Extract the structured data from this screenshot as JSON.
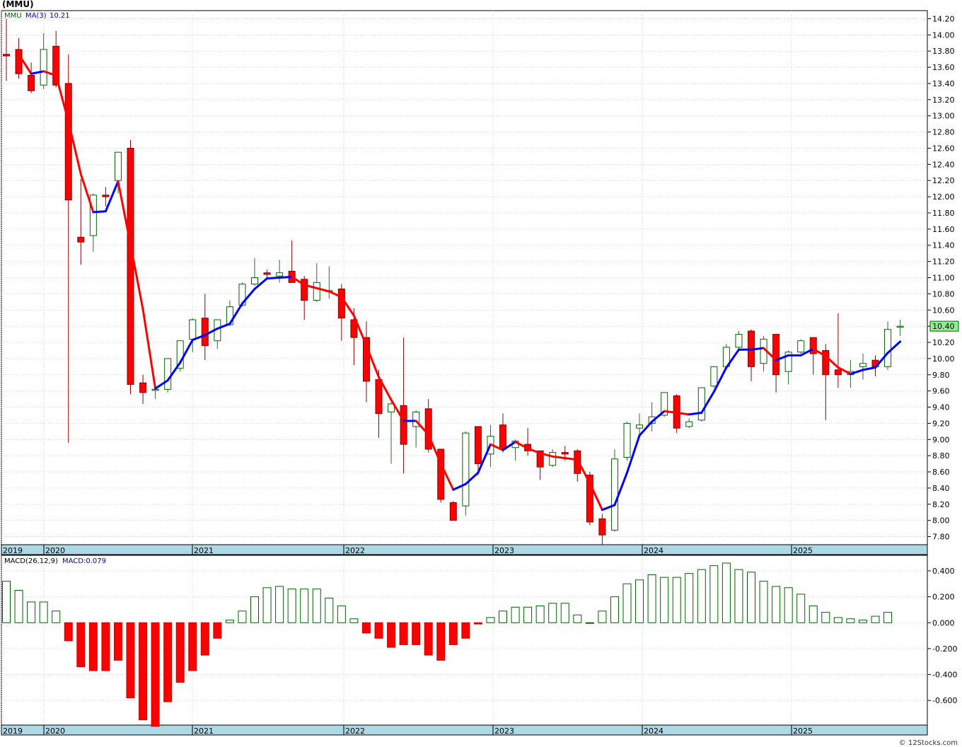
{
  "title": "(MMU)",
  "credit": "© 12Stocks.com",
  "chart_data": [
    {
      "type": "candlestick",
      "symbol": "MMU",
      "legend": {
        "symbol_label": "MMU",
        "ma_label": "MA(3)",
        "ma_value": "10.21"
      },
      "last_price_label": "10.40",
      "y_ticks": [
        "14.20",
        "14.00",
        "13.80",
        "13.60",
        "13.40",
        "13.20",
        "13.00",
        "12.80",
        "12.60",
        "12.40",
        "12.20",
        "12.00",
        "11.80",
        "11.60",
        "11.40",
        "11.20",
        "11.00",
        "10.80",
        "10.60",
        "10.40",
        "10.20",
        "10.00",
        "9.80",
        "9.60",
        "9.40",
        "9.20",
        "9.00",
        "8.80",
        "8.60",
        "8.40",
        "8.20",
        "8.00",
        "7.80"
      ],
      "ylim": [
        7.7,
        14.3
      ],
      "x_labels": [
        "2019",
        "2020",
        "2021",
        "2022",
        "2023",
        "2024",
        "2025"
      ],
      "grid": true,
      "candles": [
        {
          "o": 13.76,
          "h": 14.2,
          "l": 13.43,
          "c": 13.74
        },
        {
          "o": 13.82,
          "h": 13.96,
          "l": 13.46,
          "c": 13.52
        },
        {
          "o": 13.5,
          "h": 13.66,
          "l": 13.28,
          "c": 13.31
        },
        {
          "o": 13.38,
          "h": 14.02,
          "l": 13.33,
          "c": 13.82
        },
        {
          "o": 13.86,
          "h": 14.05,
          "l": 13.35,
          "c": 13.38
        },
        {
          "o": 13.4,
          "h": 13.76,
          "l": 8.96,
          "c": 11.96
        },
        {
          "o": 11.5,
          "h": 12.22,
          "l": 11.16,
          "c": 11.44
        },
        {
          "o": 11.52,
          "h": 12.04,
          "l": 11.32,
          "c": 12.02
        },
        {
          "o": 12.02,
          "h": 12.12,
          "l": 11.88,
          "c": 12.0
        },
        {
          "o": 12.2,
          "h": 12.55,
          "l": 12.04,
          "c": 12.55
        },
        {
          "o": 12.6,
          "h": 12.7,
          "l": 9.56,
          "c": 9.68
        },
        {
          "o": 9.7,
          "h": 9.8,
          "l": 9.44,
          "c": 9.58
        },
        {
          "o": 9.62,
          "h": 9.64,
          "l": 9.5,
          "c": 9.62
        },
        {
          "o": 9.62,
          "h": 10.0,
          "l": 9.58,
          "c": 10.0
        },
        {
          "o": 9.88,
          "h": 10.22,
          "l": 9.84,
          "c": 10.22
        },
        {
          "o": 10.24,
          "h": 10.5,
          "l": 10.08,
          "c": 10.48
        },
        {
          "o": 10.5,
          "h": 10.8,
          "l": 9.98,
          "c": 10.16
        },
        {
          "o": 10.22,
          "h": 10.48,
          "l": 10.12,
          "c": 10.48
        },
        {
          "o": 10.42,
          "h": 10.72,
          "l": 10.4,
          "c": 10.64
        },
        {
          "o": 10.66,
          "h": 10.94,
          "l": 10.64,
          "c": 10.92
        },
        {
          "o": 10.92,
          "h": 11.24,
          "l": 10.9,
          "c": 11.0
        },
        {
          "o": 11.06,
          "h": 11.1,
          "l": 10.98,
          "c": 11.04
        },
        {
          "o": 11.02,
          "h": 11.22,
          "l": 10.94,
          "c": 11.06
        },
        {
          "o": 11.08,
          "h": 11.46,
          "l": 10.94,
          "c": 10.94
        },
        {
          "o": 10.98,
          "h": 11.02,
          "l": 10.48,
          "c": 10.72
        },
        {
          "o": 10.72,
          "h": 11.18,
          "l": 10.7,
          "c": 10.94
        },
        {
          "o": 10.84,
          "h": 11.14,
          "l": 10.74,
          "c": 10.84
        },
        {
          "o": 10.86,
          "h": 10.92,
          "l": 10.22,
          "c": 10.5
        },
        {
          "o": 10.48,
          "h": 10.62,
          "l": 9.92,
          "c": 10.26
        },
        {
          "o": 10.26,
          "h": 10.46,
          "l": 9.46,
          "c": 9.72
        },
        {
          "o": 9.74,
          "h": 9.86,
          "l": 9.02,
          "c": 9.32
        },
        {
          "o": 9.34,
          "h": 9.46,
          "l": 8.7,
          "c": 9.44
        },
        {
          "o": 9.42,
          "h": 10.26,
          "l": 8.58,
          "c": 8.94
        },
        {
          "o": 9.16,
          "h": 9.36,
          "l": 8.9,
          "c": 9.34
        },
        {
          "o": 9.38,
          "h": 9.5,
          "l": 8.84,
          "c": 8.88
        },
        {
          "o": 8.88,
          "h": 8.88,
          "l": 8.22,
          "c": 8.26
        },
        {
          "o": 8.22,
          "h": 8.24,
          "l": 8.06,
          "c": 8.0
        },
        {
          "o": 8.18,
          "h": 9.1,
          "l": 8.06,
          "c": 9.08
        },
        {
          "o": 9.16,
          "h": 9.16,
          "l": 8.56,
          "c": 8.7
        },
        {
          "o": 8.82,
          "h": 9.18,
          "l": 8.66,
          "c": 9.04
        },
        {
          "o": 9.18,
          "h": 9.32,
          "l": 8.84,
          "c": 8.88
        },
        {
          "o": 8.9,
          "h": 9.0,
          "l": 8.74,
          "c": 8.98
        },
        {
          "o": 8.94,
          "h": 9.14,
          "l": 8.8,
          "c": 8.86
        },
        {
          "o": 8.86,
          "h": 8.86,
          "l": 8.5,
          "c": 8.66
        },
        {
          "o": 8.68,
          "h": 8.88,
          "l": 8.66,
          "c": 8.84
        },
        {
          "o": 8.84,
          "h": 8.92,
          "l": 8.74,
          "c": 8.82
        },
        {
          "o": 8.86,
          "h": 8.88,
          "l": 8.48,
          "c": 8.58
        },
        {
          "o": 8.56,
          "h": 8.6,
          "l": 7.94,
          "c": 7.98
        },
        {
          "o": 8.02,
          "h": 8.08,
          "l": 7.7,
          "c": 7.82
        },
        {
          "o": 7.88,
          "h": 8.88,
          "l": 7.86,
          "c": 8.76
        },
        {
          "o": 8.78,
          "h": 9.22,
          "l": 8.74,
          "c": 9.2
        },
        {
          "o": 9.14,
          "h": 9.32,
          "l": 9.02,
          "c": 9.18
        },
        {
          "o": 9.2,
          "h": 9.46,
          "l": 9.1,
          "c": 9.28
        },
        {
          "o": 9.3,
          "h": 9.58,
          "l": 9.28,
          "c": 9.58
        },
        {
          "o": 9.54,
          "h": 9.56,
          "l": 9.08,
          "c": 9.14
        },
        {
          "o": 9.16,
          "h": 9.26,
          "l": 9.14,
          "c": 9.22
        },
        {
          "o": 9.24,
          "h": 9.64,
          "l": 9.22,
          "c": 9.64
        },
        {
          "o": 9.66,
          "h": 9.9,
          "l": 9.64,
          "c": 9.9
        },
        {
          "o": 9.9,
          "h": 10.18,
          "l": 9.86,
          "c": 10.14
        },
        {
          "o": 10.14,
          "h": 10.34,
          "l": 10.12,
          "c": 10.3
        },
        {
          "o": 10.34,
          "h": 10.36,
          "l": 9.72,
          "c": 9.9
        },
        {
          "o": 9.94,
          "h": 10.28,
          "l": 9.84,
          "c": 10.24
        },
        {
          "o": 10.3,
          "h": 10.3,
          "l": 9.58,
          "c": 9.8
        },
        {
          "o": 9.84,
          "h": 10.1,
          "l": 9.68,
          "c": 10.08
        },
        {
          "o": 10.08,
          "h": 10.24,
          "l": 10.06,
          "c": 10.22
        },
        {
          "o": 10.26,
          "h": 10.26,
          "l": 9.8,
          "c": 10.06
        },
        {
          "o": 10.1,
          "h": 10.18,
          "l": 9.24,
          "c": 9.8
        },
        {
          "o": 9.86,
          "h": 10.56,
          "l": 9.64,
          "c": 9.8
        },
        {
          "o": 9.8,
          "h": 9.98,
          "l": 9.64,
          "c": 9.84
        },
        {
          "o": 9.9,
          "h": 10.06,
          "l": 9.74,
          "c": 9.94
        },
        {
          "o": 9.98,
          "h": 10.04,
          "l": 9.78,
          "c": 9.9
        },
        {
          "o": 9.9,
          "h": 10.46,
          "l": 9.86,
          "c": 10.36
        },
        {
          "o": 10.4,
          "h": 10.48,
          "l": 10.28,
          "c": 10.4
        }
      ],
      "ma3": [
        null,
        13.76,
        13.52,
        13.55,
        13.5,
        12.93,
        12.28,
        11.81,
        11.82,
        12.19,
        11.41,
        10.61,
        9.63,
        9.73,
        9.95,
        10.23,
        10.29,
        10.37,
        10.43,
        10.68,
        10.86,
        10.99,
        11.0,
        11.01,
        10.91,
        10.87,
        10.83,
        10.76,
        10.53,
        10.16,
        9.77,
        9.49,
        9.23,
        9.23,
        9.06,
        8.7,
        8.38,
        8.45,
        8.59,
        8.94,
        8.87,
        8.97,
        8.89,
        8.83,
        8.79,
        8.77,
        8.75,
        8.46,
        8.13,
        8.19,
        8.59,
        9.05,
        9.22,
        9.35,
        9.33,
        9.31,
        9.33,
        9.59,
        9.89,
        10.11,
        10.11,
        10.13,
        9.98,
        10.04,
        10.04,
        10.12,
        10.03,
        9.89,
        9.81,
        9.86,
        9.89,
        10.07,
        10.21
      ],
      "ma3_label_value": "10.21"
    },
    {
      "type": "bar",
      "name": "MACD",
      "legend": {
        "params_label": "MACD(26,12,9)",
        "value_label": "MACD:0.079"
      },
      "y_ticks": [
        "0.400",
        "0.200",
        "0.000",
        "-0.200",
        "-0.400",
        "-0.600"
      ],
      "ylim": [
        -0.79,
        0.52
      ],
      "x_labels": [
        "2019",
        "2020",
        "2021",
        "2022",
        "2023",
        "2024",
        "2025"
      ],
      "values": [
        0.32,
        0.25,
        0.16,
        0.16,
        0.09,
        -0.14,
        -0.34,
        -0.37,
        -0.37,
        -0.29,
        -0.58,
        -0.75,
        -0.8,
        -0.61,
        -0.46,
        -0.37,
        -0.25,
        -0.12,
        0.02,
        0.09,
        0.2,
        0.27,
        0.28,
        0.26,
        0.26,
        0.26,
        0.19,
        0.13,
        0.03,
        -0.08,
        -0.12,
        -0.19,
        -0.17,
        -0.17,
        -0.25,
        -0.29,
        -0.17,
        -0.12,
        -0.01,
        0.04,
        0.09,
        0.12,
        0.12,
        0.13,
        0.15,
        0.15,
        0.06,
        0.0,
        0.09,
        0.2,
        0.3,
        0.33,
        0.37,
        0.35,
        0.35,
        0.38,
        0.41,
        0.44,
        0.46,
        0.41,
        0.39,
        0.32,
        0.28,
        0.27,
        0.22,
        0.13,
        0.08,
        0.04,
        0.03,
        0.02,
        0.05,
        0.08
      ]
    }
  ]
}
